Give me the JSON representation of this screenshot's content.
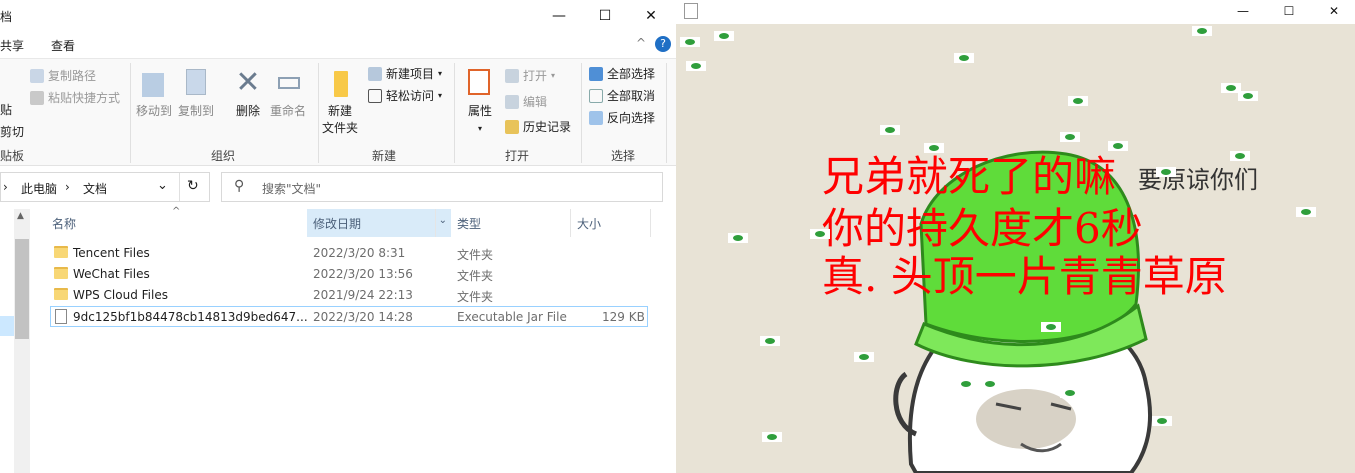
{
  "explorer": {
    "title_fragment": "档",
    "window_controls": {
      "minimize": "—",
      "maximize": "☐",
      "close": "✕"
    },
    "menu": {
      "share": "共享",
      "view": "查看"
    },
    "ribbon": {
      "clipboard": {
        "copy_path": "复制路径",
        "paste_shortcut": "粘贴快捷方式",
        "paste_fragment": "贴",
        "cut": "剪切",
        "group_label_fragment": "贴板"
      },
      "organize": {
        "move_to": "移动到",
        "copy_to": "复制到",
        "delete": "删除",
        "rename": "重命名",
        "group_label": "组织"
      },
      "new": {
        "new_folder": "新建\n文件夹",
        "new_item": "新建项目",
        "easy_access": "轻松访问",
        "group_label": "新建"
      },
      "open": {
        "properties": "属性",
        "open": "打开",
        "edit": "编辑",
        "history": "历史记录",
        "group_label": "打开"
      },
      "select": {
        "select_all": "全部选择",
        "select_none": "全部取消",
        "invert_selection": "反向选择",
        "group_label": "选择"
      },
      "collapse_icon": "^",
      "help_icon": "?"
    },
    "address": {
      "pc": "此电脑",
      "separator": "›",
      "folder": "文档"
    },
    "search": {
      "placeholder": "搜索\"文档\""
    },
    "columns": {
      "name": "名称",
      "modified": "修改日期",
      "type": "类型",
      "size": "大小"
    },
    "files": [
      {
        "name": "Tencent Files",
        "modified": "2022/3/20 8:31",
        "type": "文件夹",
        "size": ""
      },
      {
        "name": "WeChat Files",
        "modified": "2022/3/20 13:56",
        "type": "文件夹",
        "size": ""
      },
      {
        "name": "WPS Cloud Files",
        "modified": "2021/9/24 22:13",
        "type": "文件夹",
        "size": ""
      },
      {
        "name": "9dc125bf1b84478cb14813d9bed647...",
        "modified": "2022/3/20 14:28",
        "type": "Executable Jar File",
        "size": "129 KB"
      }
    ]
  },
  "java_window": {
    "window_controls": {
      "minimize": "—",
      "maximize": "☐",
      "close": "✕"
    },
    "meme_lines": [
      "兄弟就死了的嘛",
      "你的持久度才6秒",
      "真. 头顶一片青青草原"
    ],
    "caption": "要原谅你们"
  },
  "colors": {
    "meme_red": "#ff0000",
    "hat_green": "#5fdc3a",
    "selection_border": "#99d1ff",
    "sorted_header": "#d9ebf9"
  }
}
